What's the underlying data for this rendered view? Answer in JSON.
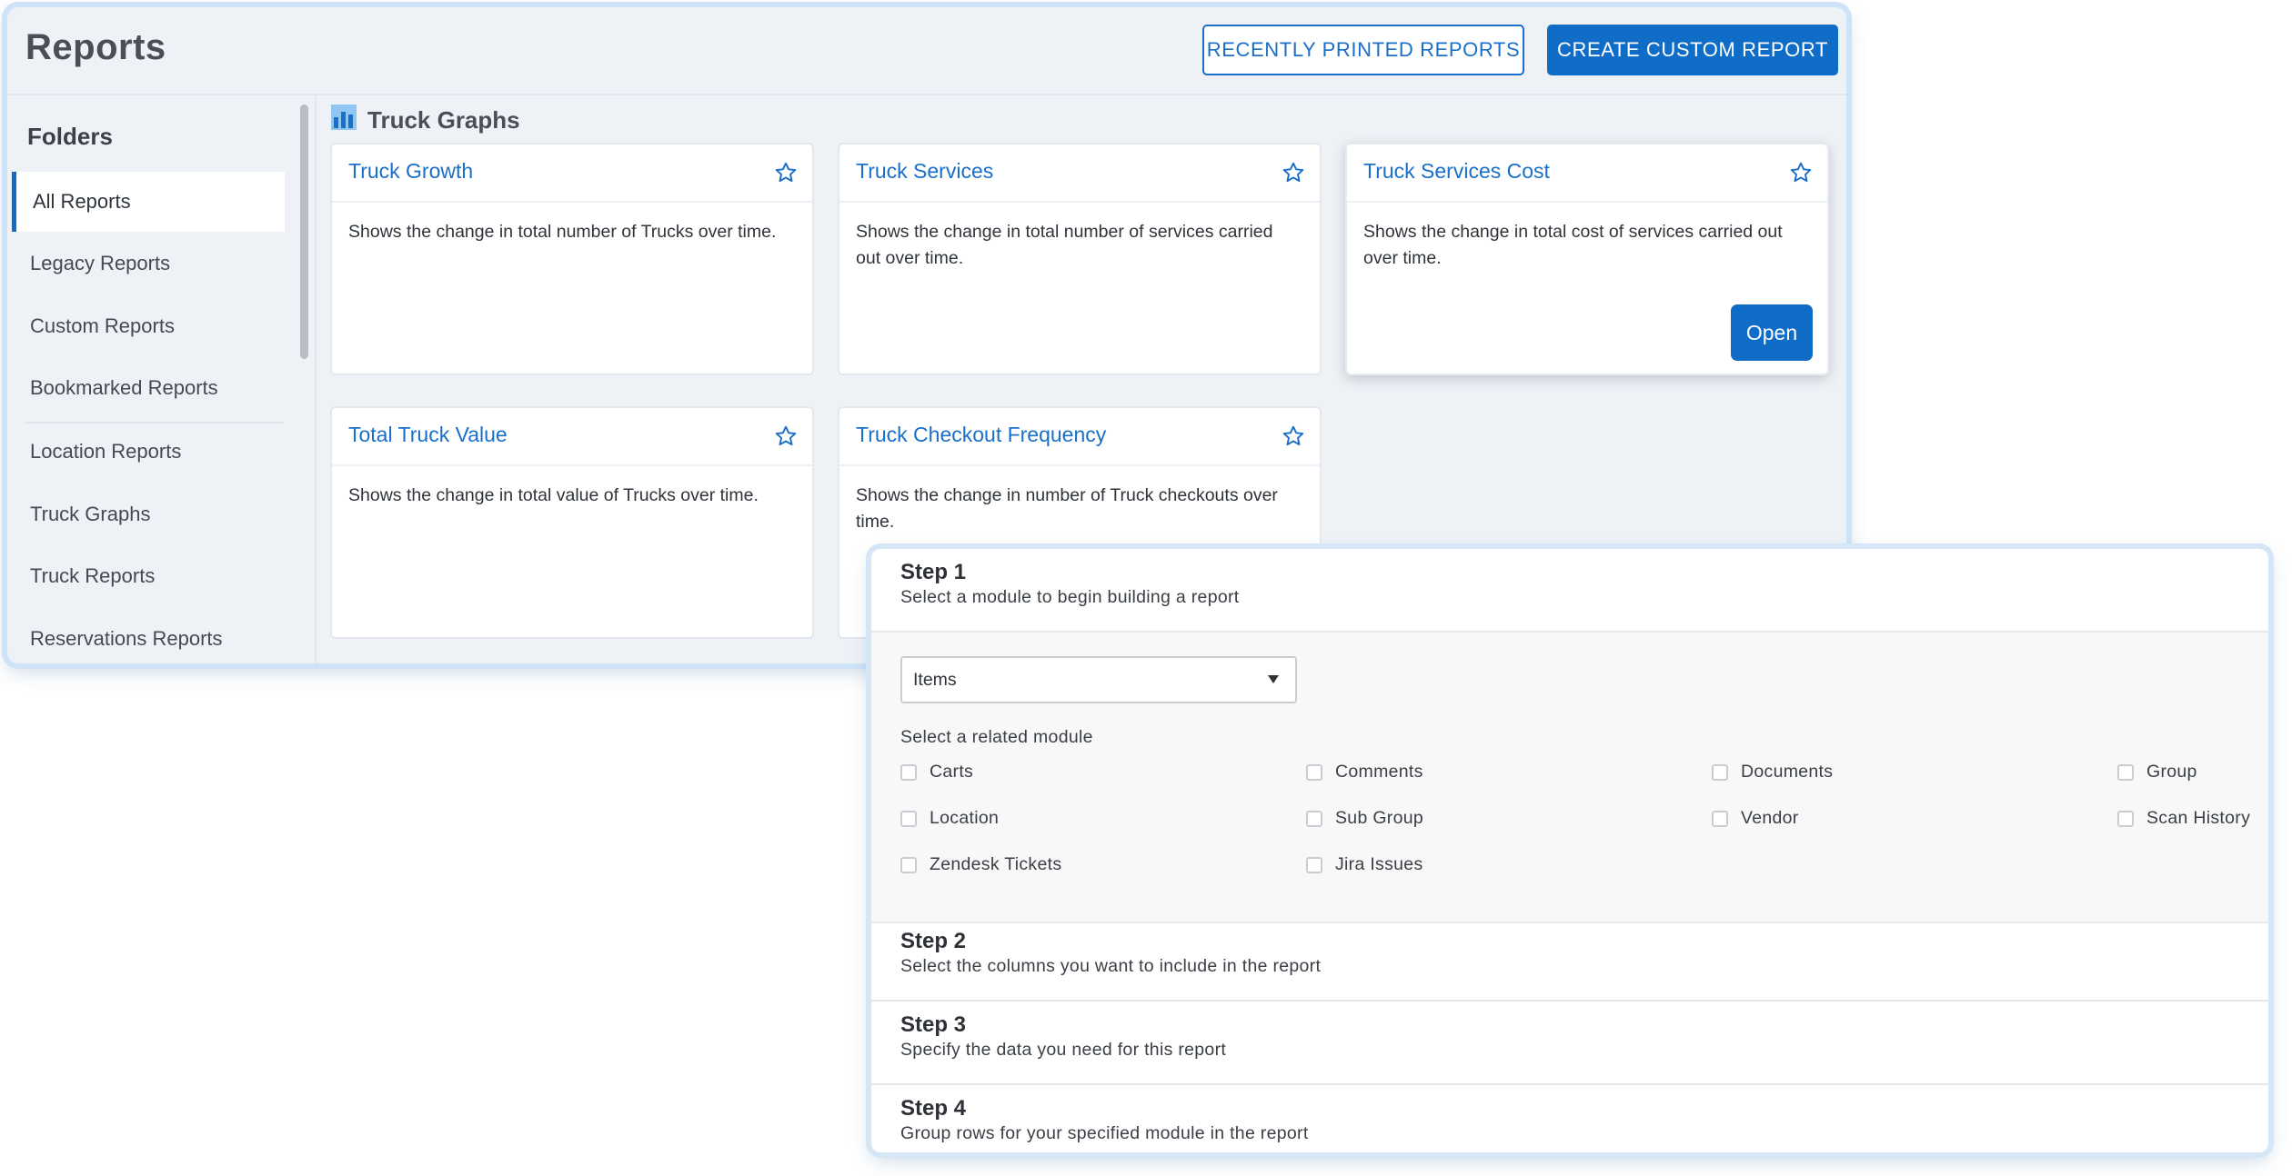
{
  "header": {
    "title": "Reports",
    "recent_label": "RECENTLY PRINTED REPORTS",
    "create_label": "CREATE CUSTOM REPORT"
  },
  "sidebar": {
    "heading": "Folders",
    "items": [
      {
        "label": "All Reports"
      },
      {
        "label": "Legacy Reports"
      },
      {
        "label": "Custom Reports"
      },
      {
        "label": "Bookmarked Reports"
      },
      {
        "label": "Location Reports"
      },
      {
        "label": "Truck Graphs"
      },
      {
        "label": "Truck Reports"
      },
      {
        "label": "Reservations Reports"
      }
    ]
  },
  "section": {
    "title": "Truck Graphs",
    "icon": "bar-chart-icon"
  },
  "cards": [
    {
      "title": "Truck Growth",
      "desc": "Shows the change in total number of Trucks over time."
    },
    {
      "title": "Truck Services",
      "desc": "Shows the change in total number of services carried out over time."
    },
    {
      "title": "Truck Services Cost",
      "desc": "Shows the change in total cost of services carried out over time.",
      "open_label": "Open"
    },
    {
      "title": "Total Truck Value",
      "desc": "Shows the change in total value of Trucks over time."
    },
    {
      "title": "Truck Checkout Frequency",
      "desc": "Shows the change in number of Truck checkouts over time."
    }
  ],
  "wizard": {
    "step1": {
      "title": "Step 1",
      "subtitle": "Select a module to begin building a report",
      "selected_module": "Items",
      "related_label": "Select a related module",
      "modules": [
        "Carts",
        "Comments",
        "Documents",
        "Group",
        "Location",
        "Sub Group",
        "Vendor",
        "Scan History",
        "Zendesk Tickets",
        "Jira Issues"
      ]
    },
    "step2": {
      "title": "Step 2",
      "subtitle": "Select the columns you want to include in the report"
    },
    "step3": {
      "title": "Step 3",
      "subtitle": "Specify the data you need for this report"
    },
    "step4": {
      "title": "Step 4",
      "subtitle": "Group rows for your specified module in the report"
    }
  },
  "colors": {
    "accent": "#0f6dc8",
    "link": "#1a6fc8",
    "panel_bg": "#eef2f7"
  }
}
